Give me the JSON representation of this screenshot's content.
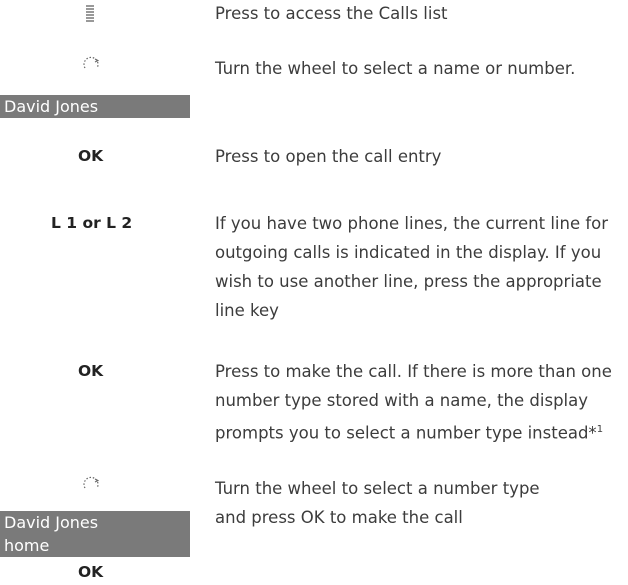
{
  "steps": [
    {
      "desc": "Press to access the Calls list",
      "icon": "calls-list-icon"
    },
    {
      "desc": "Turn the wheel to select a name or number.",
      "icon": "wheel-icon",
      "display": [
        "David Jones"
      ]
    },
    {
      "key": "OK",
      "desc": "Press to open the call entry"
    },
    {
      "key": "L 1 or L 2",
      "desc": "If you have two phone lines, the current line for outgoing calls is indicated in the display. If you wish to use another line, press the appropriate line key"
    },
    {
      "key": "OK",
      "desc": "Press to make the call. If there is more than one number type stored with a name, the display prompts you to select a number type instead*1"
    },
    {
      "desc": "Turn the wheel to select a number type and press OK to make the call",
      "icon": "wheel-icon",
      "display": [
        "David Jones",
        "home"
      ],
      "key_after": "OK"
    }
  ],
  "colors": {
    "display_bg": "#7a7a7a",
    "text": "#3c3c3c"
  }
}
